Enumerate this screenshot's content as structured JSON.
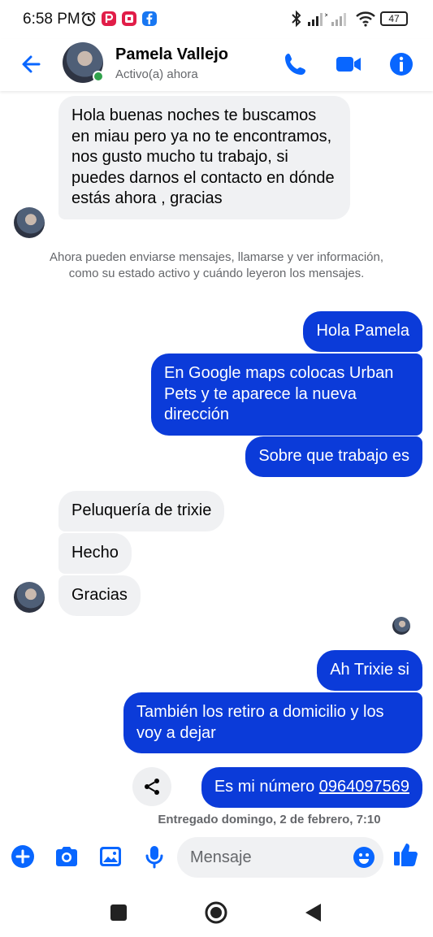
{
  "status_bar": {
    "time": "6:58 PM",
    "battery": "47"
  },
  "header": {
    "contact_name": "Pamela Vallejo",
    "contact_status": "Activo(a) ahora"
  },
  "messages": [
    {
      "from": "them",
      "text": "Hola buenas noches te buscamos en miau pero ya no te encontramos, nos gusto mucho tu trabajo, si puedes darnos el contacto en dónde estás ahora , gracias"
    },
    {
      "from": "system",
      "text": "Ahora pueden enviarse mensajes, llamarse y ver información, como su estado activo y cuándo leyeron los mensajes."
    },
    {
      "from": "me",
      "text": "Hola Pamela"
    },
    {
      "from": "me",
      "text": "En Google maps colocas Urban Pets y te aparece la nueva dirección"
    },
    {
      "from": "me",
      "text": "Sobre que trabajo es"
    },
    {
      "from": "them",
      "text": "Peluquería de trixie"
    },
    {
      "from": "them",
      "text": "Hecho"
    },
    {
      "from": "them",
      "text": "Gracias"
    },
    {
      "from": "me",
      "text": "Ah Trixie si"
    },
    {
      "from": "me",
      "text": "También los retiro a domicilio y los voy a dejar"
    },
    {
      "from": "me",
      "text_prefix": "Es mi número ",
      "phone": "0964097569"
    }
  ],
  "delivery_status": "Entregado domingo, 2 de febrero, 7:10",
  "composer": {
    "placeholder": "Mensaje"
  },
  "colors": {
    "accent": "#0866ff",
    "outgoing_bubble": "#0b3bd9",
    "incoming_bubble": "#f0f1f3",
    "online": "#31a24c"
  },
  "icons": [
    "back-arrow-icon",
    "phone-icon",
    "video-icon",
    "info-icon",
    "share-icon",
    "plus-icon",
    "camera-icon",
    "gallery-icon",
    "microphone-icon",
    "emoji-icon",
    "thumbs-up-icon",
    "recents-icon",
    "home-icon",
    "back-nav-icon"
  ]
}
